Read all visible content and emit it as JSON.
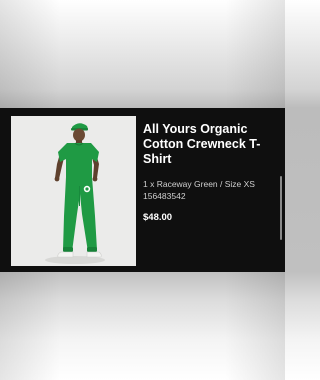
{
  "product": {
    "title": "All Yours Organic Cotton Crewneck T-Shirt",
    "variant": "1 x Raceway Green / Size XS",
    "sku": "156483542",
    "price": "$48.00",
    "image_icon": "product-photo-model-in-green-outfit"
  },
  "colors": {
    "card_background": "#0f0f0f",
    "image_background": "#ebebea",
    "garment_green": "#1f9a44"
  }
}
